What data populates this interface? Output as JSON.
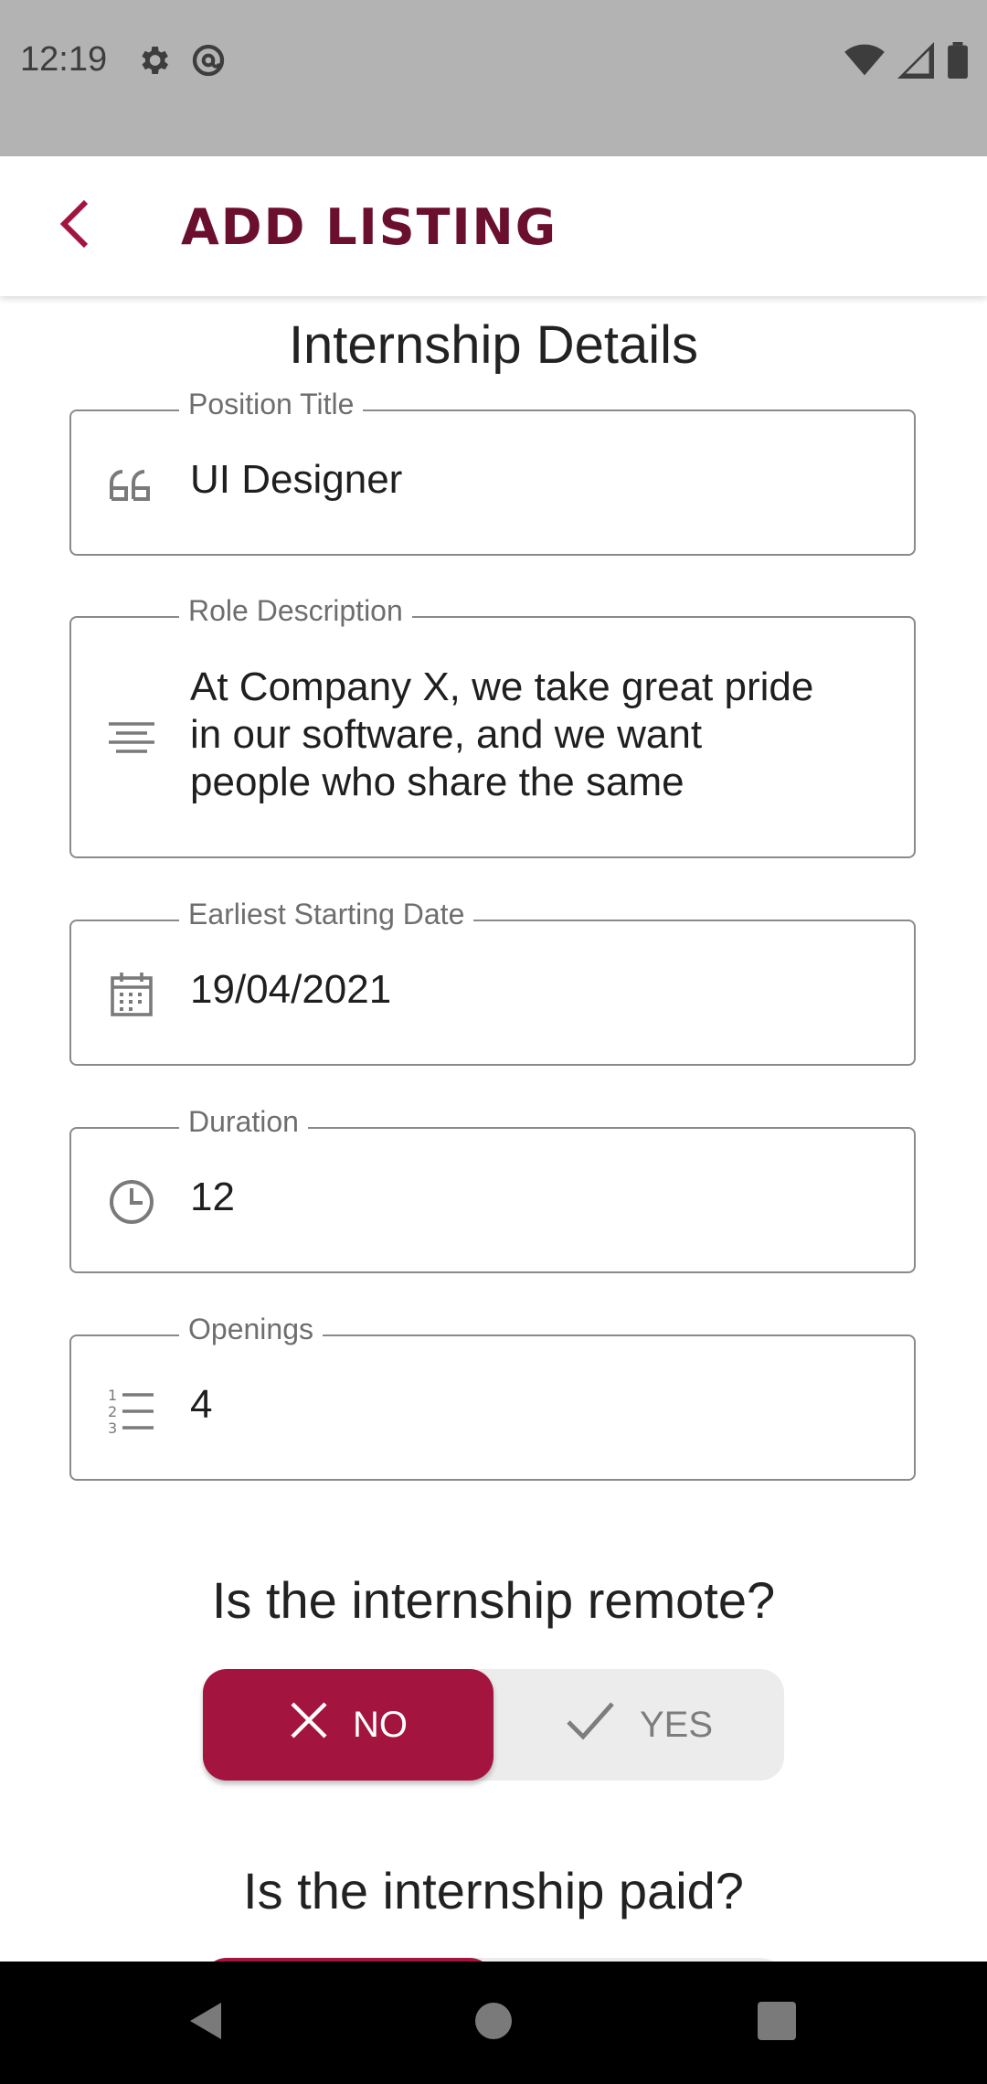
{
  "status_bar": {
    "time": "12:19",
    "icons_left": [
      "settings-icon",
      "at-sign-icon"
    ],
    "icons_right": [
      "wifi-icon",
      "signal-icon",
      "battery-icon"
    ]
  },
  "app_bar": {
    "title": "ADD LISTING",
    "back_icon": "chevron-left-icon",
    "accent_color": "#6b0f2e"
  },
  "section": {
    "title": "Internship Details"
  },
  "fields": {
    "position_title": {
      "label": "Position Title",
      "value": "UI Designer",
      "icon": "quote-icon"
    },
    "role_description": {
      "label": "Role Description",
      "lines": [
        "At Company X, we take great pride",
        "in our software, and we want",
        "people who share the same"
      ],
      "icon": "text-align-icon"
    },
    "start_date": {
      "label": "Earliest Starting Date",
      "value": "19/04/2021",
      "icon": "calendar-icon"
    },
    "duration": {
      "label": "Duration",
      "value": "12",
      "icon": "clock-icon"
    },
    "openings": {
      "label": "Openings",
      "value": "4",
      "icon": "numbered-list-icon"
    }
  },
  "remote_question": {
    "text": "Is the internship remote?",
    "no_label": "NO",
    "yes_label": "YES",
    "selected": "NO"
  },
  "paid_question": {
    "text": "Is the internship paid?"
  },
  "colors": {
    "primary": "#a3143f",
    "toggle_bg": "#ececec"
  },
  "nav_bar": {
    "icons": [
      "back-triangle-icon",
      "home-circle-icon",
      "recents-square-icon"
    ]
  }
}
